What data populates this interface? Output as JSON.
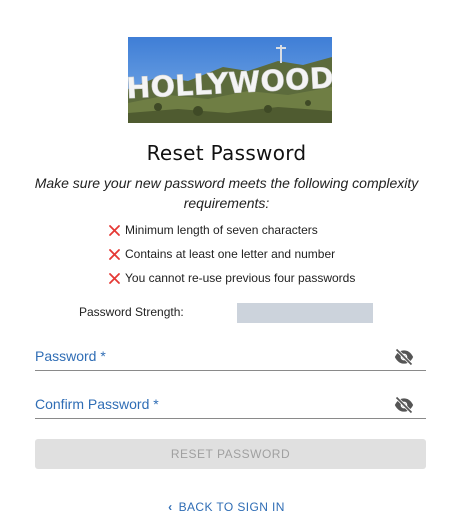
{
  "hero": {
    "sign_text": "HOLLYWOOD"
  },
  "title": "Reset Password",
  "subtitle": "Make sure your new password meets the following complexity requirements:",
  "requirements": [
    {
      "label": "Minimum length of seven characters",
      "status_icon": "x-icon",
      "met": false
    },
    {
      "label": "Contains at least one letter and number",
      "status_icon": "x-icon",
      "met": false
    },
    {
      "label": "You cannot re-use previous four passwords",
      "status_icon": "x-icon",
      "met": false
    }
  ],
  "strength": {
    "label": "Password Strength:",
    "value": 0
  },
  "fields": {
    "password": {
      "label": "Password *",
      "value": "",
      "icon": "eye-off-icon"
    },
    "confirm": {
      "label": "Confirm Password *",
      "value": "",
      "icon": "eye-off-icon"
    }
  },
  "reset_button": {
    "label": "RESET PASSWORD",
    "disabled": true
  },
  "back_link": {
    "label": "BACK TO SIGN IN",
    "icon": "chevron-left-icon"
  },
  "colors": {
    "accent": "#2f6db5",
    "error": "#e53935",
    "strength_track": "#ccd3dc",
    "button_disabled_bg": "#e0e0e0",
    "button_disabled_text": "#a0a0a0"
  }
}
